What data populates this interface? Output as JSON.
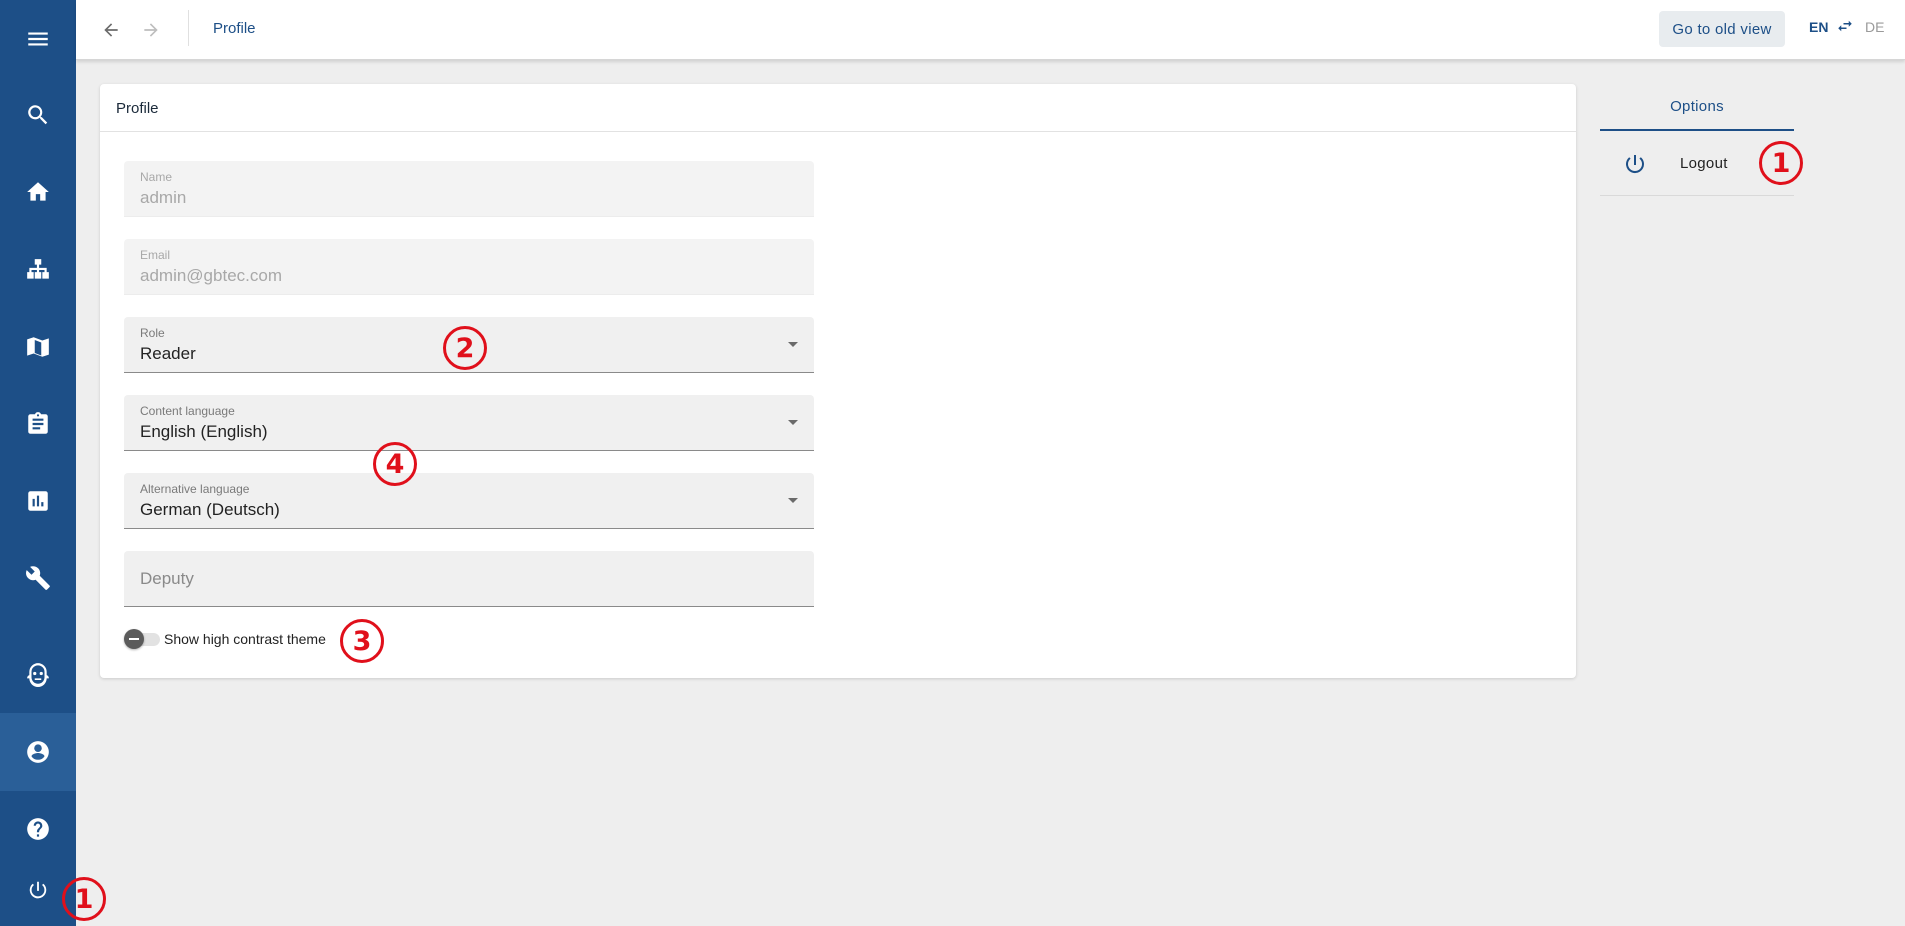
{
  "topbar": {
    "breadcrumb": "Profile",
    "old_view_label": "Go to old view",
    "lang_active": "EN",
    "lang_inactive": "DE"
  },
  "sidebar": {
    "items": [
      {
        "name": "menu",
        "icon": "hamburger-menu-icon"
      },
      {
        "name": "search",
        "icon": "search-icon"
      },
      {
        "name": "home",
        "icon": "home-icon"
      },
      {
        "name": "hierarchy",
        "icon": "sitemap-icon"
      },
      {
        "name": "map",
        "icon": "book-map-icon"
      },
      {
        "name": "clipboard",
        "icon": "clipboard-icon"
      },
      {
        "name": "reports",
        "icon": "bar-chart-icon"
      },
      {
        "name": "tools",
        "icon": "wrench-icon"
      },
      {
        "name": "assistant",
        "icon": "robot-icon"
      },
      {
        "name": "profile",
        "icon": "account-circle-icon",
        "active": true
      },
      {
        "name": "help",
        "icon": "help-circle-icon"
      },
      {
        "name": "logout",
        "icon": "power-icon"
      }
    ]
  },
  "profile": {
    "title": "Profile",
    "fields": {
      "name": {
        "label": "Name",
        "value": "admin"
      },
      "email": {
        "label": "Email",
        "value": "admin@gbtec.com"
      },
      "role": {
        "label": "Role",
        "value": "Reader"
      },
      "content_language": {
        "label": "Content language",
        "value": "English (English)"
      },
      "alternative_language": {
        "label": "Alternative language",
        "value": "German (Deutsch)"
      },
      "deputy": {
        "placeholder": "Deputy"
      }
    },
    "high_contrast": {
      "label": "Show high contrast theme",
      "checked": false
    }
  },
  "options": {
    "title": "Options",
    "logout_label": "Logout"
  },
  "annotations": {
    "m1": "1",
    "m2": "2",
    "m3": "3",
    "m4": "4"
  },
  "colors": {
    "primary": "#1d4f87",
    "annotation": "#e0101b",
    "background": "#eeeeee"
  }
}
